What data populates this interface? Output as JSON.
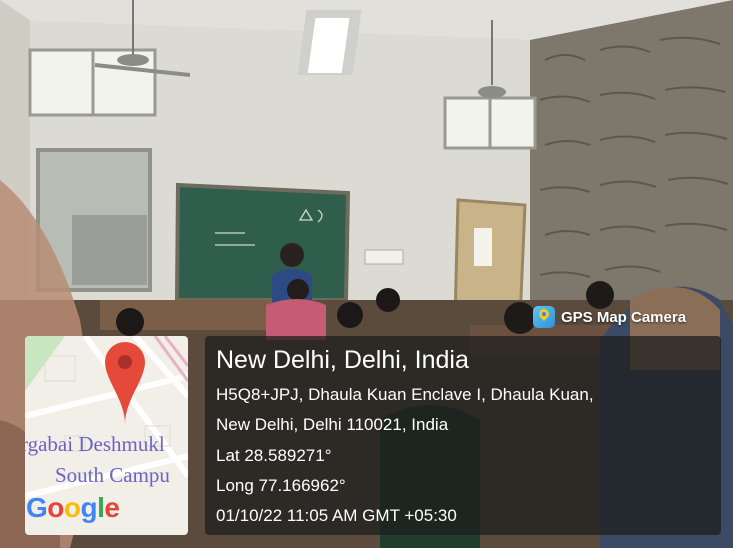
{
  "photo": {
    "description_icon": "classroom-photo"
  },
  "overlay": {
    "app_badge": {
      "icon": "gps-map-camera-icon",
      "label": "GPS Map Camera"
    },
    "location": {
      "city_line": "New Delhi, Delhi, India",
      "address_line1": "H5Q8+JPJ, Dhaula Kuan Enclave I, Dhaula Kuan,",
      "address_line2": "New Delhi, Delhi 110021, India",
      "lat": "Lat 28.589271°",
      "long": "Long 77.166962°",
      "timestamp": "01/10/22 11:05 AM GMT +05:30"
    },
    "map": {
      "poi_line1": "rgabai Deshmukl",
      "poi_line2": "South Campu",
      "logo_letters": [
        "G",
        "o",
        "o",
        "g",
        "l",
        "e"
      ],
      "logo_colors": [
        "#4285F4",
        "#EA4335",
        "#FBBC05",
        "#4285F4",
        "#34A853",
        "#EA4335"
      ],
      "pin_color": "#E5493A"
    }
  }
}
